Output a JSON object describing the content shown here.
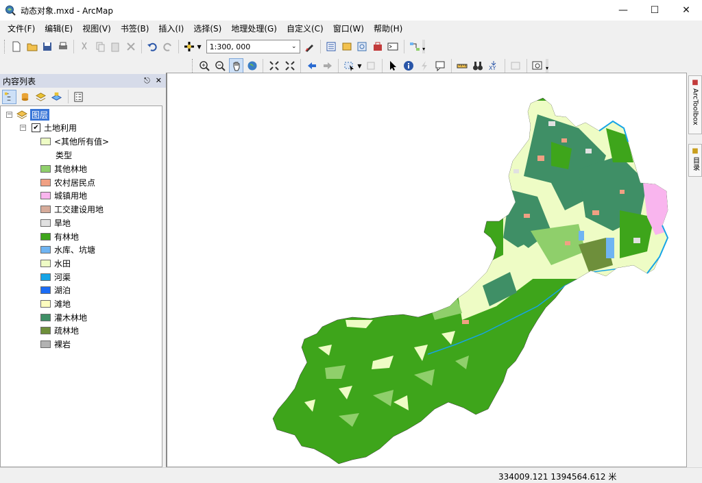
{
  "window": {
    "title": "动态对象.mxd - ArcMap",
    "minimize_icon": "minimize-icon",
    "maximize_icon": "maximize-icon",
    "close_icon": "close-icon"
  },
  "menu": {
    "items": [
      "文件(F)",
      "编辑(E)",
      "视图(V)",
      "书签(B)",
      "插入(I)",
      "选择(S)",
      "地理处理(G)",
      "自定义(C)",
      "窗口(W)",
      "帮助(H)"
    ]
  },
  "standard_toolbar": {
    "scale_value": "1:300, 000"
  },
  "toc": {
    "title": "内容列表",
    "pin_icon": "pin-icon",
    "close_icon": "close-icon",
    "layers_root": "图层",
    "layer_name": "土地利用",
    "other_values": "<其他所有值>",
    "field_heading": "类型",
    "legend": [
      {
        "label": "其他林地",
        "color": "#8fcf6b"
      },
      {
        "label": "农村居民点",
        "color": "#f0a083"
      },
      {
        "label": "城镇用地",
        "color": "#f9b5ee"
      },
      {
        "label": "工交建设用地",
        "color": "#d6ab9a"
      },
      {
        "label": "旱地",
        "color": "#e1e1e1"
      },
      {
        "label": "有林地",
        "color": "#3ea51b"
      },
      {
        "label": "水库、坑塘",
        "color": "#6fb4f2"
      },
      {
        "label": "水田",
        "color": "#eefcc5"
      },
      {
        "label": "河渠",
        "color": "#16a4e6"
      },
      {
        "label": "湖泊",
        "color": "#1b6cf5"
      },
      {
        "label": "滩地",
        "color": "#fdfdbf"
      },
      {
        "label": "灌木林地",
        "color": "#3f8f66"
      },
      {
        "label": "疏林地",
        "color": "#6e8f3b"
      },
      {
        "label": "裸岩",
        "color": "#b2b2b2"
      }
    ],
    "other_values_color": "#eefcc5"
  },
  "side_tabs": {
    "arctoolbox": "ArcToolbox",
    "catalog": "目录"
  },
  "status": {
    "coordinates": "334009.121  1394564.612 米"
  }
}
